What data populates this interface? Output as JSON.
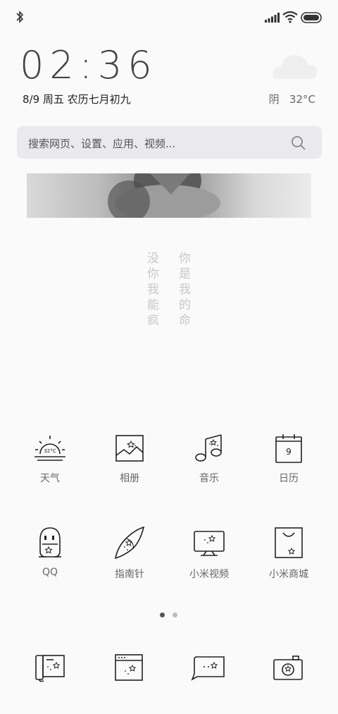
{
  "status_bar": {
    "icons": [
      "bluetooth-icon",
      "signal-icon",
      "wifi-icon",
      "battery-icon"
    ]
  },
  "clock": {
    "time": "02:36"
  },
  "date": {
    "text": "8/9 周五 农历七月初九"
  },
  "weather": {
    "text": "阴   32°C",
    "icon": "cloud-icon"
  },
  "search": {
    "placeholder": "搜索网页、设置、应用、视频..."
  },
  "poem": {
    "col1": [
      "没",
      "你",
      "我",
      "能",
      "疯"
    ],
    "col2": [
      "你",
      "是",
      "我",
      "的",
      "命"
    ]
  },
  "apps": [
    {
      "label": "天气",
      "icon": "sunrise-icon",
      "temp": "32°C"
    },
    {
      "label": "相册",
      "icon": "gallery-icon"
    },
    {
      "label": "音乐",
      "icon": "music-note-icon"
    },
    {
      "label": "日历",
      "icon": "calendar-icon",
      "day": "9"
    },
    {
      "label": "QQ",
      "icon": "penguin-icon"
    },
    {
      "label": "指南针",
      "icon": "compass-icon"
    },
    {
      "label": "小米视频",
      "icon": "tv-icon"
    },
    {
      "label": "小米商城",
      "icon": "shopping-bag-icon"
    }
  ],
  "page_indicator": {
    "pages": 2,
    "current": 1
  },
  "dock": [
    {
      "icon": "phone-icon"
    },
    {
      "icon": "browser-icon"
    },
    {
      "icon": "message-icon"
    },
    {
      "icon": "camera-icon"
    }
  ],
  "colors": {
    "background": "#fafafa",
    "search_bg": "#e9e9ee",
    "icon_stroke": "#222"
  }
}
